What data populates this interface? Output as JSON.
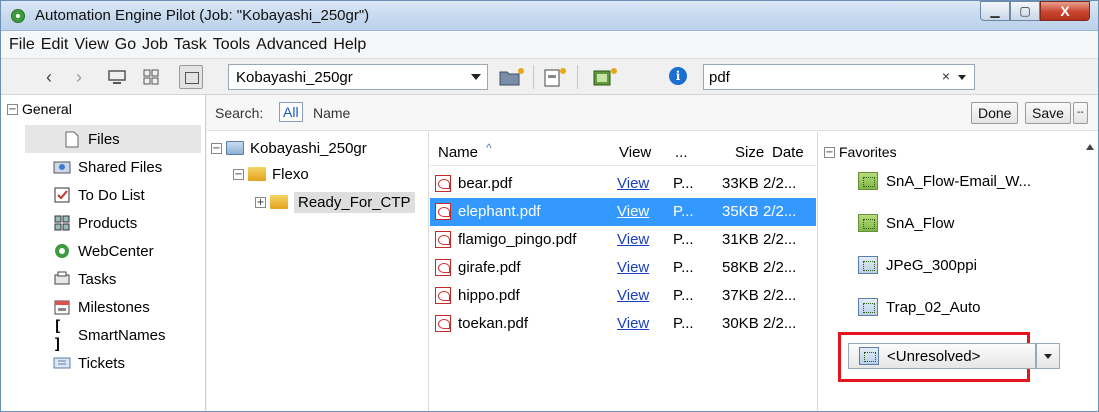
{
  "window": {
    "title": "Automation Engine Pilot (Job: \"Kobayashi_250gr\")",
    "controls": [
      "minimize-icon",
      "maximize-icon",
      "close-icon"
    ],
    "close_glyph": "X"
  },
  "menubar": {
    "items": [
      "File",
      "Edit",
      "View",
      "Go",
      "Job",
      "Task",
      "Tools",
      "Advanced",
      "Help"
    ]
  },
  "toolbar": {
    "job_selector_value": "Kobayashi_250gr",
    "search_value": "pdf",
    "search_clear": "×",
    "icons": [
      "back-icon",
      "forward-icon",
      "computer-icon",
      "grid-view-icon",
      "panel-toggle-icon",
      "new-folder-icon",
      "new-file-icon",
      "new-job-icon",
      "info-icon"
    ],
    "info_glyph": "i"
  },
  "sidebar": {
    "section_label": "General",
    "items": [
      {
        "label": "Files",
        "icon": "file-icon",
        "selected": true
      },
      {
        "label": "Shared Files",
        "icon": "shared-files-icon"
      },
      {
        "label": "To Do List",
        "icon": "checklist-icon"
      },
      {
        "label": "Products",
        "icon": "products-icon"
      },
      {
        "label": "WebCenter",
        "icon": "webcenter-icon"
      },
      {
        "label": "Tasks",
        "icon": "tasks-icon"
      },
      {
        "label": "Milestones",
        "icon": "milestones-icon"
      },
      {
        "label": "SmartNames",
        "icon": "smartnames-icon"
      },
      {
        "label": "Tickets",
        "icon": "tickets-icon"
      }
    ]
  },
  "search_bar": {
    "label": "Search:",
    "scope_all": "All",
    "scope_name": "Name",
    "done_label": "Done",
    "save_label": "Save",
    "more_label": "--"
  },
  "folder_tree": {
    "root": "Kobayashi_250gr",
    "child": "Flexo",
    "grandchild": "Ready_For_CTP"
  },
  "file_list": {
    "columns": {
      "name": "Name",
      "view": "View",
      "more": "...",
      "size": "Size",
      "date": "Date"
    },
    "sort_indicator": "^",
    "rows": [
      {
        "name": "bear.pdf",
        "view": "View",
        "type": "P...",
        "size": "33KB",
        "date": "2/2..."
      },
      {
        "name": "elephant.pdf",
        "view": "View",
        "type": "P...",
        "size": "35KB",
        "date": "2/2...",
        "selected": true
      },
      {
        "name": "flamigo_pingo.pdf",
        "view": "View",
        "type": "P...",
        "size": "31KB",
        "date": "2/2..."
      },
      {
        "name": "girafe.pdf",
        "view": "View",
        "type": "P...",
        "size": "58KB",
        "date": "2/2..."
      },
      {
        "name": "hippo.pdf",
        "view": "View",
        "type": "P...",
        "size": "37KB",
        "date": "2/2..."
      },
      {
        "name": "toekan.pdf",
        "view": "View",
        "type": "P...",
        "size": "30KB",
        "date": "2/2..."
      }
    ]
  },
  "favorites": {
    "section_label": "Favorites",
    "items": [
      {
        "label": "SnA_Flow-Email_W...",
        "icon": "workflow-icon"
      },
      {
        "label": "SnA_Flow",
        "icon": "workflow-icon"
      },
      {
        "label": "JPeG_300ppi",
        "icon": "ticket-icon"
      },
      {
        "label": "Trap_02_Auto",
        "icon": "ticket-icon"
      }
    ],
    "unresolved_label": "<Unresolved>"
  },
  "colors": {
    "selection": "#3399ff",
    "highlight_box": "#e8141c",
    "link": "#1a3fbf"
  }
}
